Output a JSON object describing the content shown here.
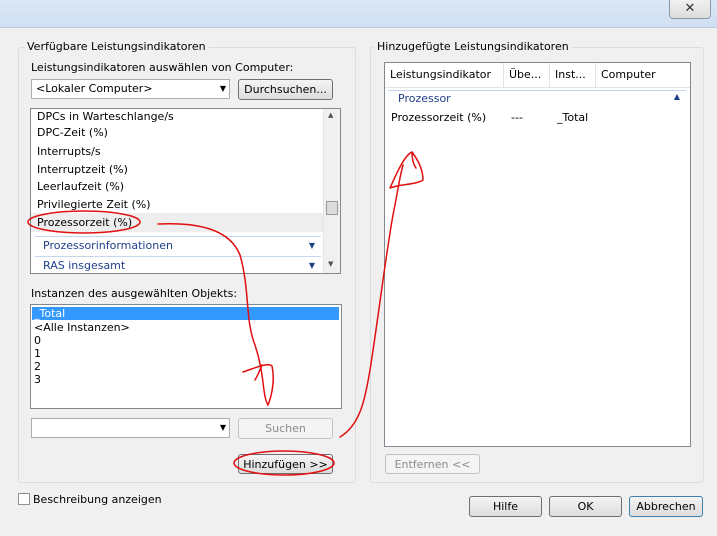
{
  "left": {
    "group_title": "Verfügbare Leistungsindikatoren",
    "computer_label": "Leistungsindikatoren auswählen von Computer:",
    "computer_value": "<Lokaler Computer>",
    "browse_label": "Durchsuchen...",
    "counters": [
      "DPCs in Warteschlange/s",
      "DPC-Zeit (%)",
      "Interrupts/s",
      "Interruptzeit (%)",
      "Leerlaufzeit (%)",
      "Privilegierte Zeit (%)",
      "Prozessorzeit (%)"
    ],
    "categories": [
      "Prozessorinformationen",
      "RAS insgesamt"
    ],
    "instances_label": "Instanzen des ausgewählten Objekts:",
    "instances": [
      "_Total",
      "<Alle Instanzen>",
      "0",
      "1",
      "2",
      "3"
    ],
    "search_value": "",
    "search_label": "Suchen",
    "add_label": "Hinzufügen >>"
  },
  "right": {
    "group_title": "Hinzugefügte Leistungsindikatoren",
    "columns": [
      "Leistungsindikator",
      "Übe...",
      "Inst...",
      "Computer"
    ],
    "category": "Prozessor",
    "rows": [
      {
        "counter": "Prozessorzeit (%)",
        "parent": "---",
        "instance": "_Total",
        "computer": ""
      }
    ],
    "remove_label": "Entfernen <<"
  },
  "footer": {
    "show_description": "Beschreibung anzeigen",
    "help_label": "Hilfe",
    "ok_label": "OK",
    "cancel_label": "Abbrechen"
  },
  "colors": {
    "annotation": "#e01010",
    "selection": "#3399ff",
    "category_text": "#1e3f8a"
  }
}
